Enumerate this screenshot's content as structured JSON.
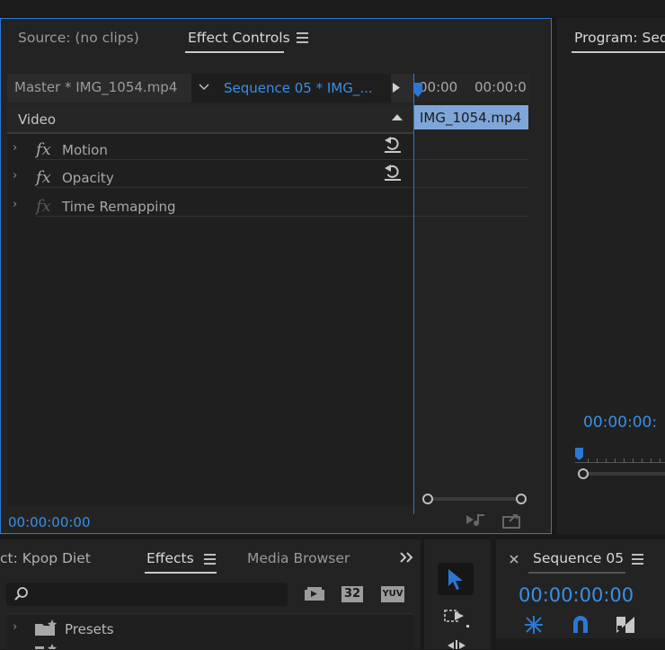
{
  "effect_controls_panel": {
    "tabs": [
      {
        "label": "Source: (no clips)"
      },
      {
        "label": "Effect Controls"
      }
    ],
    "master_clip_label": "Master * IMG_1054.mp4",
    "sequence_selector_label": "Sequence 05 * IMG_...",
    "ruler_times": [
      "00:00",
      "00:00:0"
    ],
    "clip_bar_label": "IMG_1054.mp4",
    "section_label": "Video",
    "properties": [
      {
        "label": "Motion",
        "enabled": true,
        "has_reset": true
      },
      {
        "label": "Opacity",
        "enabled": true,
        "has_reset": true
      },
      {
        "label": "Time Remapping",
        "enabled": false,
        "has_reset": false
      }
    ],
    "timecode": "00:00:00:00",
    "fx_glyph": "fx"
  },
  "program_panel": {
    "tab_label": "Program: Seq",
    "timecode": "00:00:00:"
  },
  "effects_panel": {
    "tabs": [
      {
        "label": "ct: Kpop Diet"
      },
      {
        "label": "Effects"
      },
      {
        "label": "Media Browser"
      }
    ],
    "search_value": "",
    "filter_badges": [
      "32",
      "YUV"
    ],
    "tree_items": [
      {
        "label": "Presets"
      }
    ]
  },
  "sequence_panel": {
    "tab_label": "Sequence 05",
    "timecode": "00:00:00:00"
  },
  "colors": {
    "accent_blue": "#2b78d4",
    "timecode_blue": "#3a8fe6",
    "clip_bar": "#7ea6d8"
  }
}
